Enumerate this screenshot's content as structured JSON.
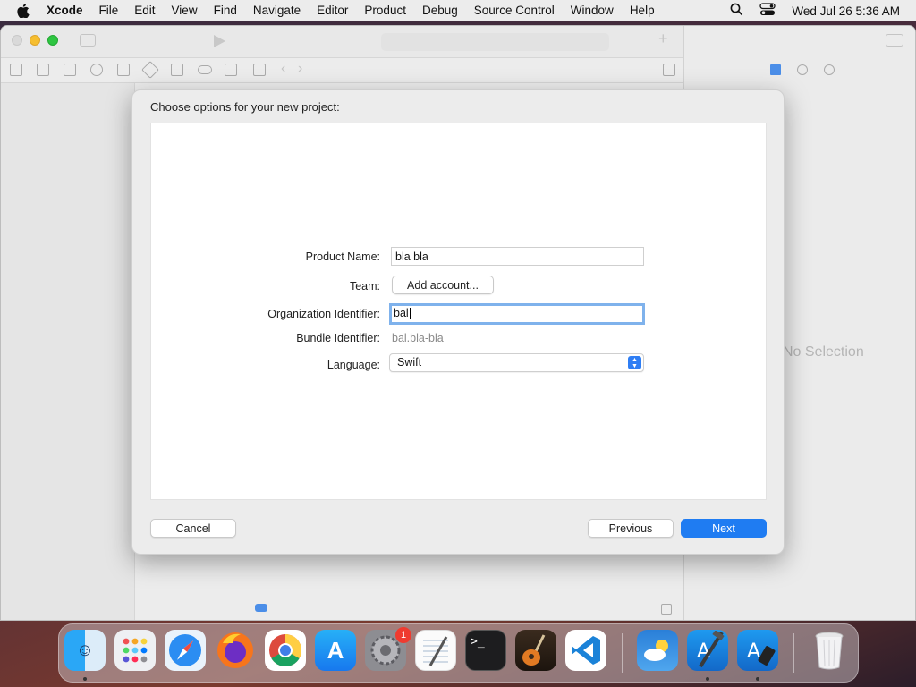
{
  "menubar": {
    "app_name": "Xcode",
    "items": [
      "File",
      "Edit",
      "View",
      "Find",
      "Navigate",
      "Editor",
      "Product",
      "Debug",
      "Source Control",
      "Window",
      "Help"
    ],
    "clock": "Wed Jul 26  5:36 AM"
  },
  "inspector": {
    "no_selection": "No Selection"
  },
  "dialog": {
    "title": "Choose options for your new project:",
    "product_name_label": "Product Name:",
    "product_name_value": "bla bla",
    "team_label": "Team:",
    "team_button": "Add account...",
    "org_id_label": "Organization Identifier:",
    "org_id_value": "bal",
    "bundle_id_label": "Bundle Identifier:",
    "bundle_id_value": "bal.bla-bla",
    "language_label": "Language:",
    "language_value": "Swift",
    "cancel_button": "Cancel",
    "previous_button": "Previous",
    "next_button": "Next"
  },
  "dock": {
    "apps": [
      "Finder",
      "Launchpad",
      "Safari",
      "Firefox",
      "Chrome",
      "App Store",
      "System Settings",
      "TextEdit",
      "Terminal",
      "GarageBand",
      "Visual Studio Code",
      "Weather",
      "Xcode",
      "Simulator",
      "Trash"
    ],
    "settings_badge": "1"
  },
  "colors": {
    "accent": "#1f7cf2",
    "focus_ring": "#7fb2ec",
    "badge": "#ef3b30"
  }
}
